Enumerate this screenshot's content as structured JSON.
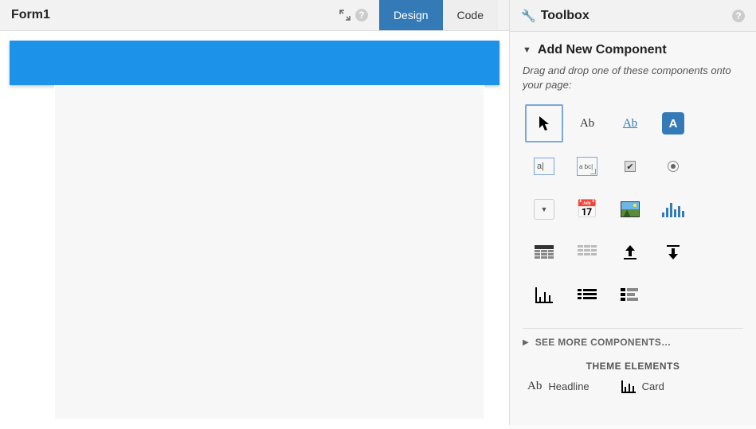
{
  "left": {
    "title": "Form1",
    "tabs": {
      "design": "Design",
      "code": "Code"
    },
    "help": "?"
  },
  "right": {
    "title": "Toolbox",
    "help": "?",
    "addNew": {
      "title": "Add New Component",
      "desc": "Drag and drop one of these components onto your page:"
    },
    "seeMore": "SEE MORE COMPONENTS…",
    "themeTitle": "THEME ELEMENTS",
    "theme": {
      "headline": "Headline",
      "card": "Card"
    }
  },
  "components": {
    "label": "Ab",
    "link": "Ab",
    "button": "A",
    "textbox": "a|",
    "textarea": "a bc|",
    "checkbox": "✔",
    "dropdown": "▼",
    "datepicker": "📅"
  }
}
